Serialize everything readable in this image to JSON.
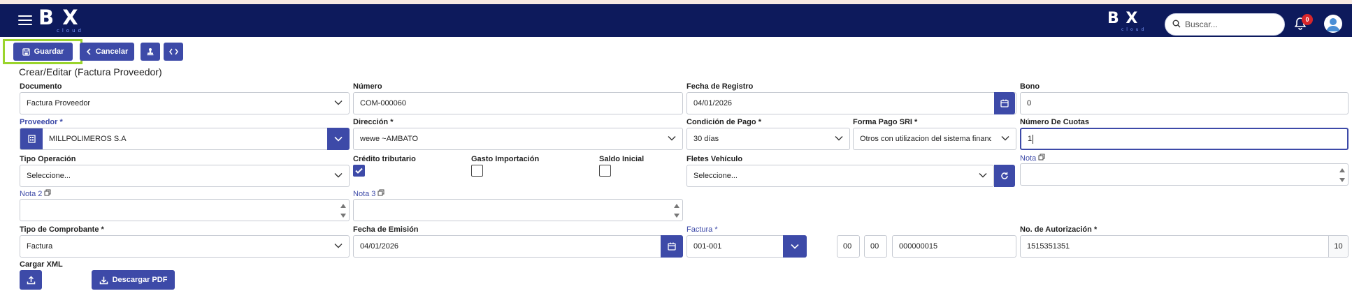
{
  "navbar": {
    "logo_text": "B X",
    "logo_sub": "cloud",
    "search_placeholder": "Buscar...",
    "notifications_count": "0"
  },
  "toolbar": {
    "save_label": "Guardar",
    "cancel_label": "Cancelar"
  },
  "page": {
    "title": "Crear/Editar (Factura Proveedor)"
  },
  "form": {
    "documento": {
      "label": "Documento",
      "value": "Factura Proveedor"
    },
    "numero": {
      "label": "Número",
      "value": "COM-000060"
    },
    "fecha_registro": {
      "label": "Fecha de Registro",
      "value": "04/01/2026"
    },
    "bono": {
      "label": "Bono",
      "value": "0"
    },
    "proveedor": {
      "label": "Proveedor",
      "required": "*",
      "value": "MILLPOLIMEROS S.A"
    },
    "direccion": {
      "label": "Dirección",
      "required": "*",
      "value": "wewe ~AMBATO"
    },
    "condicion_pago": {
      "label": "Condición de Pago",
      "required": "*",
      "value": "30 días"
    },
    "forma_pago": {
      "label": "Forma Pago SRI",
      "required": "*",
      "value": "Otros con utilizacion del sistema financiero"
    },
    "numero_cuotas": {
      "label": "Número De Cuotas",
      "value": "1"
    },
    "tipo_operacion": {
      "label": "Tipo Operación",
      "value": "Seleccione..."
    },
    "credito_tributario": {
      "label": "Crédito tributario",
      "checked": true
    },
    "gasto_importacion": {
      "label": "Gasto Importación",
      "checked": false
    },
    "saldo_inicial": {
      "label": "Saldo Inicial",
      "checked": false
    },
    "fletes_vehiculo": {
      "label": "Fletes Vehículo",
      "value": "Seleccione..."
    },
    "nota": {
      "label": "Nota",
      "value": ""
    },
    "nota2": {
      "label": "Nota 2",
      "value": ""
    },
    "nota3": {
      "label": "Nota 3",
      "value": ""
    },
    "tipo_comprobante": {
      "label": "Tipo de Comprobante",
      "required": "*",
      "value": "Factura"
    },
    "fecha_emision": {
      "label": "Fecha de Emisión",
      "value": "04/01/2026"
    },
    "factura": {
      "label": "Factura",
      "required": "*",
      "serie": "001-001",
      "estab": "00",
      "pto": "00",
      "secuencial": "000000015"
    },
    "autorizacion": {
      "label": "No. de Autorización",
      "required": "*",
      "value": "1515351351",
      "suffix": "10"
    },
    "cargar_xml": {
      "label": "Cargar XML"
    },
    "descargar_pdf": {
      "label": "Descargar PDF"
    }
  }
}
